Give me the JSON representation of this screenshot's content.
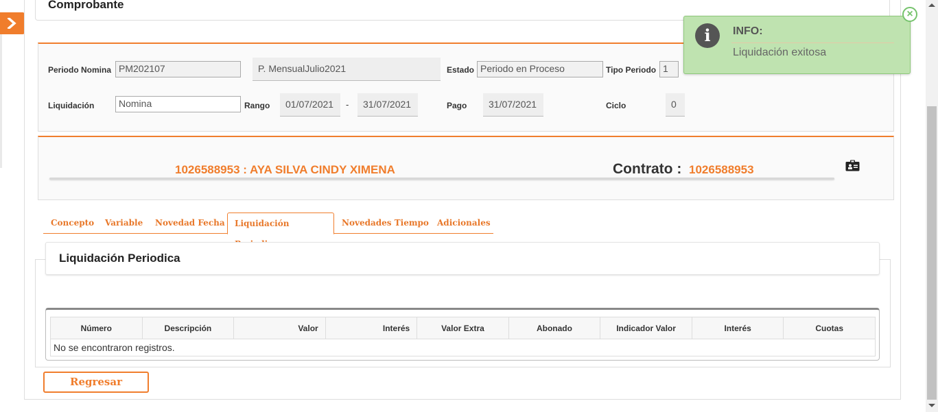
{
  "header": {
    "title": "Comprobante"
  },
  "period": {
    "periodo_nomina_label": "Periodo Nomina",
    "periodo_nomina_value": "PM202107",
    "periodo_desc": "P. MensualJulio2021",
    "estado_label": "Estado",
    "estado_value": "Periodo en Proceso",
    "tipo_periodo_label": "Tipo Periodo",
    "tipo_periodo_value": "1",
    "liquidacion_label": "Liquidación",
    "liquidacion_value": "Nomina",
    "rango_label": "Rango",
    "rango_desde": "01/07/2021",
    "rango_sep": "-",
    "rango_hasta": "31/07/2021",
    "pago_label": "Pago",
    "pago_value": "31/07/2021",
    "ciclo_label": "Ciclo",
    "ciclo_value": "0"
  },
  "employee": {
    "name": "1026588953 : AYA SILVA CINDY XIMENA",
    "contrato_label": "Contrato :",
    "contrato_value": "1026588953"
  },
  "tabs": [
    {
      "label": "Concepto"
    },
    {
      "label": "Variable"
    },
    {
      "label": "Novedad Fecha"
    },
    {
      "label": "Liquidación Periodica",
      "active": true
    },
    {
      "label": "Novedades Tiempo"
    },
    {
      "label": "Adicionales"
    }
  ],
  "section": {
    "title": "Liquidación Periodica"
  },
  "table": {
    "headers": [
      "Número",
      "Descripción",
      "Valor",
      "Interés",
      "Valor Extra",
      "Abonado",
      "Indicador Valor",
      "Interés",
      "Cuotas"
    ],
    "empty_message": "No se encontraron registros."
  },
  "buttons": {
    "back": "Regresar"
  },
  "toast": {
    "title": "INFO:",
    "message": "Liquidación exitosa",
    "close": "×"
  },
  "colors": {
    "accent": "#f07d2c",
    "toast_bg": "#bfe3b0"
  }
}
